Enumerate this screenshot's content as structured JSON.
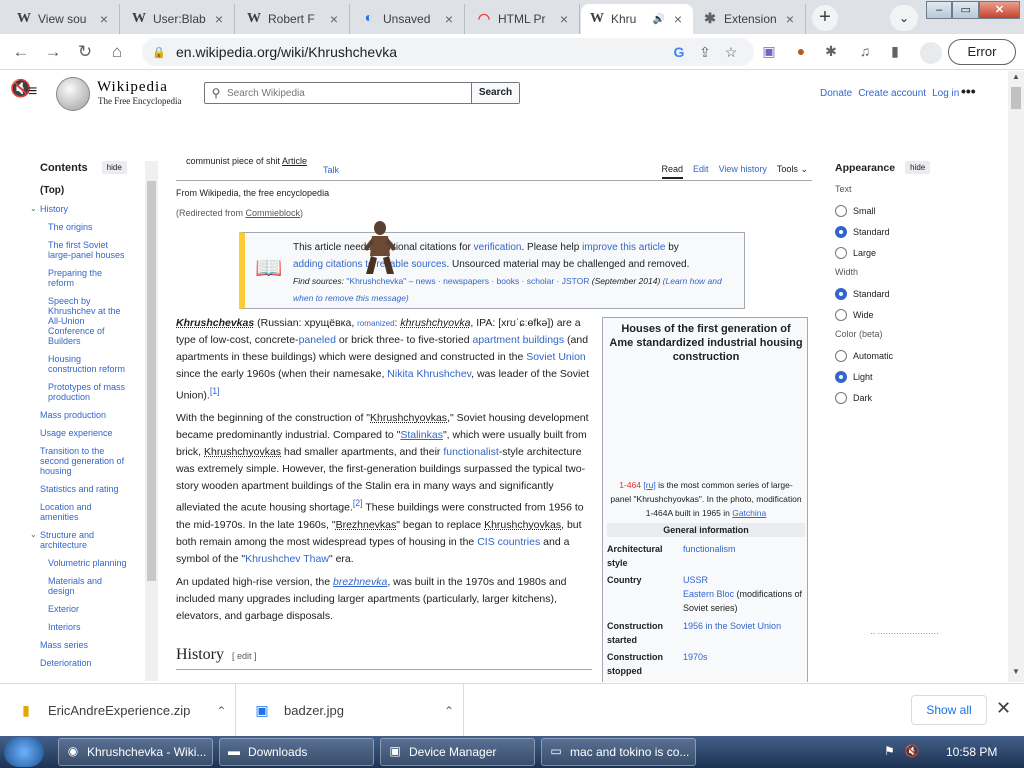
{
  "browser": {
    "tabs": [
      {
        "label": "View sou",
        "icon": "W"
      },
      {
        "label": "User:Blab",
        "icon": "W"
      },
      {
        "label": "Robert F",
        "icon": "W"
      },
      {
        "label": "Unsaved",
        "icon": "◐"
      },
      {
        "label": "HTML Pr",
        "icon": "◠"
      },
      {
        "label": "Khru",
        "icon": "W",
        "audio": "🔊"
      },
      {
        "label": "Extension",
        "icon": "✱"
      }
    ],
    "url": "en.wikipedia.org/wiki/Khrushchevka",
    "error_label": "Error"
  },
  "wiki": {
    "logo_title": "Wikipedia",
    "logo_subtitle": "The Free Encyclopedia",
    "search_placeholder": "Search Wikipedia",
    "search_button": "Search",
    "user_links": [
      "Donate",
      "Create account",
      "Log in"
    ],
    "toc": {
      "title": "Contents",
      "hide": "hide",
      "items": [
        {
          "label": "(Top)",
          "level": 0
        },
        {
          "label": "History",
          "level": 0,
          "expanded": true
        },
        {
          "label": "The origins",
          "level": 1
        },
        {
          "label": "The first Soviet large-panel houses",
          "level": 1
        },
        {
          "label": "Preparing the reform",
          "level": 1
        },
        {
          "label": "Speech by Khrushchev at the All-Union Conference of Builders",
          "level": 1
        },
        {
          "label": "Housing construction reform",
          "level": 1
        },
        {
          "label": "Prototypes of mass production",
          "level": 1
        },
        {
          "label": "Mass production",
          "level": 0
        },
        {
          "label": "Usage experience",
          "level": 0
        },
        {
          "label": "Transition to the second generation of housing",
          "level": 0
        },
        {
          "label": "Statistics and rating",
          "level": 0
        },
        {
          "label": "Location and amenities",
          "level": 0
        },
        {
          "label": "Structure and architecture",
          "level": 0,
          "expanded": true
        },
        {
          "label": "Volumetric planning",
          "level": 1
        },
        {
          "label": "Materials and design",
          "level": 1
        },
        {
          "label": "Exterior",
          "level": 1
        },
        {
          "label": "Interiors",
          "level": 1
        },
        {
          "label": "Mass series",
          "level": 0
        },
        {
          "label": "Deterioration",
          "level": 0
        }
      ]
    },
    "page_title_prefix": "communist piece of shit ",
    "page_title_link": "Article",
    "tab_talk": "Talk",
    "tabs_right": [
      "Read",
      "Edit",
      "View history",
      "Tools"
    ],
    "from": "From Wikipedia, the free encyclopedia",
    "redirect_prefix": "(Redirected from ",
    "redirect_link": "Commieblock",
    "redirect_suffix": ")",
    "ambox": {
      "line1_a": "This article needs additional citations for ",
      "line1_link": "verification",
      "line1_b": ". Please help ",
      "line1_link2": "improve this article",
      "line1_c": " by",
      "line2_link": "adding citations to reliable sources",
      "line2_b": ". Unsourced material may be challenged and removed.",
      "find_sources": "Find sources: ",
      "sources": "\"Khrushchevka\" – news · newspapers · books · scholar · JSTOR",
      "date": " (September 2014) ",
      "learn": "(Learn how and when to remove this message)"
    },
    "para1": {
      "bold": "Khrushchevkas",
      "a": " (Russian: хрущёвка, ",
      "romanized": "romanized",
      "b": ": ",
      "translit": "khrushchyovka",
      "c": ", IPA: [xrʊˈɕːɵfkə]) are a type of low-cost, concrete-",
      "paneled": "paneled",
      "d": " or brick three- to five-storied ",
      "apt": "apartment buildings",
      "e": " (and apartments in these buildings) which were designed and constructed in the ",
      "soviet": "Soviet Union",
      "f": " since the early 1960s (when their namesake, ",
      "nikita": "Nikita Khrushchev",
      "g": ", was leader of the Soviet Union).",
      "ref": "[1]"
    },
    "para2": {
      "a": "With the beginning of the construction of \"",
      "k1": "Khrushchyovkas",
      "b": ",\" Soviet housing development became predominantly industrial. Compared to \"",
      "stal": "Stalinkas",
      "c": "\", which were usually built from brick, ",
      "k2": "Khrushchyovkas",
      "d": " had smaller apartments, and their ",
      "func": "functionalist",
      "e": "-style architecture was extremely simple. However, the first-generation buildings surpassed the typical two-story wooden apartment buildings of the Stalin era in many ways and significantly alleviated the acute housing shortage.",
      "ref": "[2]",
      "f": " These buildings were constructed from 1956 to the mid-1970s. In the late 1960s, \"",
      "brezh": "Brezhnevkas",
      "g": "\" began to replace ",
      "k3": "Khrushchyovkas",
      "h": ", but both remain among the most widespread types of housing in the ",
      "cis": "CIS countries",
      "i": " and a symbol of the \"",
      "thaw": "Khrushchev Thaw",
      "j": "\" era."
    },
    "para3": {
      "a": "An updated high-rise version, the ",
      "brezh": "brezhnevka",
      "b": ", was built in the 1970s and 1980s and included many upgrades including larger apartments (particularly, larger kitchens), elevators, and garbage disposals."
    },
    "history_heading": "History",
    "edit_label": "[ edit ]",
    "infobox": {
      "title": "Houses of the first generation of Ame standardized industrial housing construction",
      "caption_link": "1-464",
      "caption_ru": "[ru]",
      "caption_a": " is the most common series of large-panel \"Khrushchyovkas\". In the photo, modification 1-464A built in 1965 in ",
      "caption_gatchina": "Gatchina",
      "section": "General information",
      "rows": [
        {
          "label": "Architectural style",
          "value": "functionalism"
        },
        {
          "label": "Country",
          "value": "USSR",
          "value2": "Eastern Bloc",
          "value3": " (modifications of Soviet series)"
        },
        {
          "label": "Construction started",
          "value": "1956 in the Soviet Union"
        },
        {
          "label": "Construction stopped",
          "value": "1970s"
        }
      ]
    },
    "appearance": {
      "title": "Appearance",
      "hide": "hide",
      "groups": [
        {
          "name": "Text",
          "options": [
            "Small",
            "Standard",
            "Large"
          ],
          "selected": "Standard"
        },
        {
          "name": "Width",
          "options": [
            "Standard",
            "Wide"
          ],
          "selected": "Standard"
        },
        {
          "name": "Color (beta)",
          "options": [
            "Automatic",
            "Light",
            "Dark"
          ],
          "selected": "Light"
        }
      ]
    }
  },
  "downloads": {
    "items": [
      "EricAndreExperience.zip",
      "badzer.jpg"
    ],
    "show_all": "Show all"
  },
  "taskbar": {
    "buttons": [
      "Khrushchevka - Wiki...",
      "Downloads",
      "Device Manager",
      "mac and tokino is co..."
    ],
    "clock": "10:58 PM"
  }
}
